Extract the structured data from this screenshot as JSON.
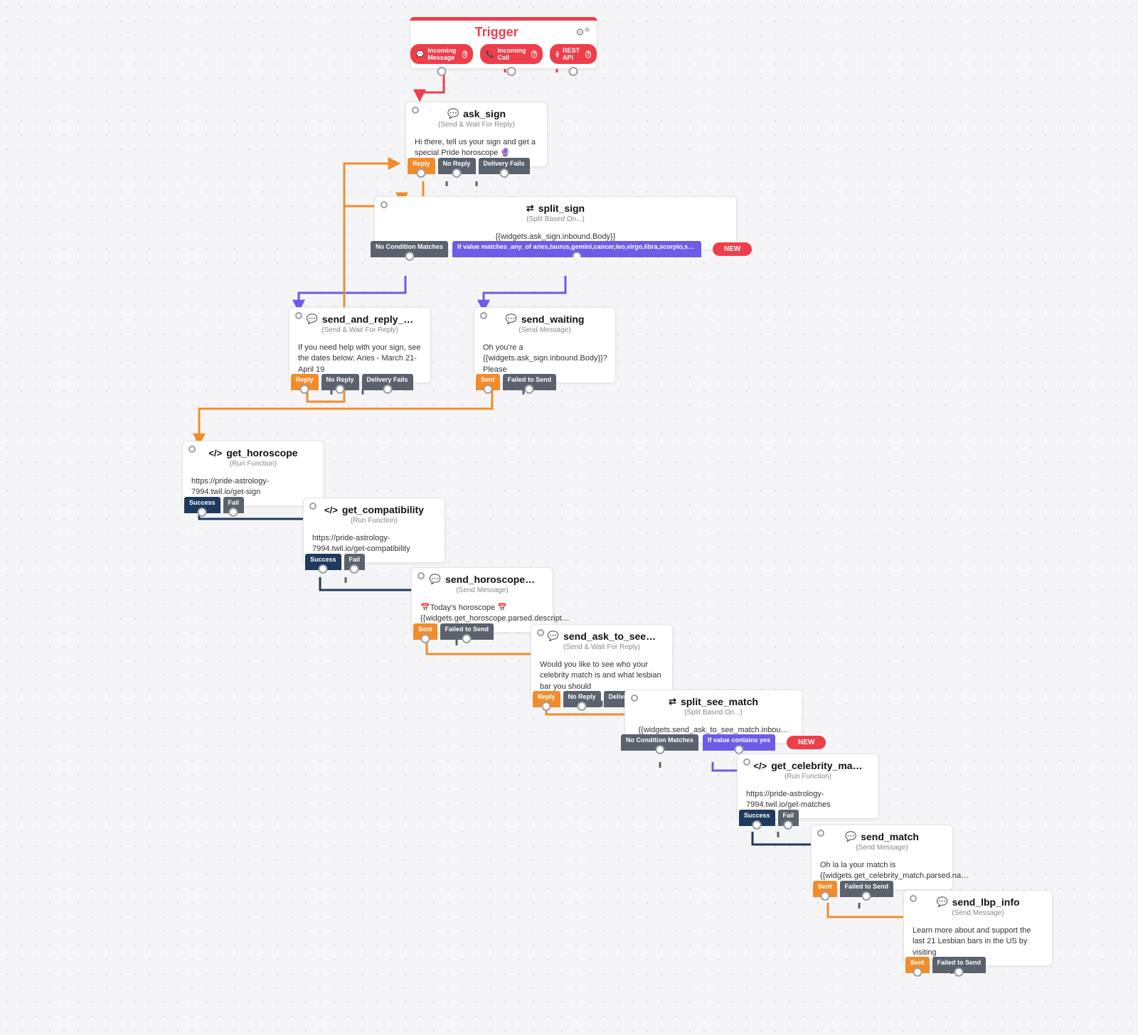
{
  "trigger": {
    "title": "Trigger",
    "ports": {
      "incoming_message": "Incoming Message",
      "incoming_call": "Incoming Call",
      "rest_api": "REST API"
    }
  },
  "labels": {
    "send_wait": "(Send & Wait For Reply)",
    "send_msg": "(Send Message)",
    "run_fn": "(Run Function)",
    "split": "(Split Based On...)",
    "reply": "Reply",
    "no_reply": "No Reply",
    "delivery_fails": "Delivery Fails",
    "sent": "Sent",
    "failed_to_send": "Failed to Send",
    "success": "Success",
    "fail": "Fail",
    "no_condition": "No Condition Matches",
    "new": "NEW"
  },
  "nodes": {
    "ask_sign": {
      "title": "ask_sign",
      "body": "Hi there, tell us your sign and get a special Pride horoscope 🔮"
    },
    "split_sign": {
      "title": "split_sign",
      "expr": "{{widgets.ask_sign.inbound.Body}}",
      "cond": "If value matches_any_of aries,taurus,gemini,cancer,leo,virgo,libra,scorpio,sagittarius,sag,capricorn,aquarius,pisces"
    },
    "send_and_reply": {
      "title": "send_and_reply_…",
      "body": "If you need help with your sign, see the dates below: Aries - March 21-April 19"
    },
    "send_waiting": {
      "title": "send_waiting",
      "body": "Oh you're a {{widgets.ask_sign.inbound.Body}}? Please"
    },
    "get_horoscope": {
      "title": "get_horoscope",
      "body": "https://pride-astrology-7994.twil.io/get-sign"
    },
    "get_compatibility": {
      "title": "get_compatibility",
      "body": "https://pride-astrology-7994.twil.io/get-compatibility"
    },
    "send_horoscope": {
      "title": "send_horoscope…",
      "body": "📅Today's horoscope 📅 {{widgets.get_horoscope.parsed.descript…"
    },
    "send_ask_to_see": {
      "title": "send_ask_to_see…",
      "body": "Would you like to see who your celebrity match is and what lesbian bar you should"
    },
    "split_see_match": {
      "title": "split_see_match",
      "expr": "{{widgets.send_ask_to_see_match.inbou…",
      "cond": "If value contains yes"
    },
    "get_celebrity_match": {
      "title": "get_celebrity_ma…",
      "body": "https://pride-astrology-7994.twil.io/get-matches"
    },
    "send_match": {
      "title": "send_match",
      "body": "Oh la la your match is {{widgets.get_celebrity_match.parsed.na…"
    },
    "send_lbp_info": {
      "title": "send_lbp_info",
      "body": "Learn more about and support the last 21 Lesbian bars in the US by visiting"
    }
  }
}
